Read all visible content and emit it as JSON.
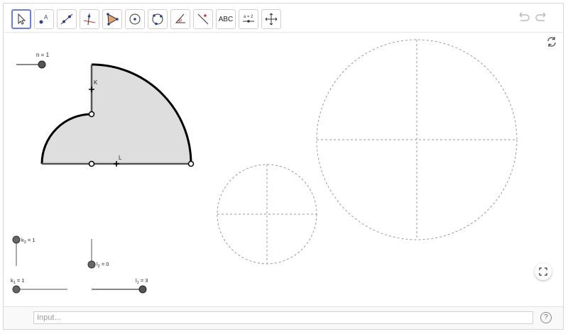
{
  "toolbar": {
    "tools": [
      {
        "name": "move",
        "icon": "arrow-cursor-icon"
      },
      {
        "name": "point",
        "icon": "point-icon"
      },
      {
        "name": "line",
        "icon": "line-icon"
      },
      {
        "name": "perpendicular",
        "icon": "perpendicular-line-icon"
      },
      {
        "name": "polygon",
        "icon": "polygon-icon"
      },
      {
        "name": "circle-center-point",
        "icon": "circle-center-icon"
      },
      {
        "name": "circle-three-points",
        "icon": "circle-three-points-icon"
      },
      {
        "name": "angle",
        "icon": "angle-icon"
      },
      {
        "name": "reflect",
        "icon": "reflect-icon"
      },
      {
        "name": "text",
        "icon": "text-icon",
        "label": "ABC"
      },
      {
        "name": "slider",
        "icon": "slider-icon",
        "label": "a = 2"
      },
      {
        "name": "move-graphics",
        "icon": "move-graphics-icon"
      }
    ],
    "undo_icon": "undo-icon",
    "redo_icon": "redo-icon"
  },
  "sliders": {
    "n_label": "n = 1",
    "k2_label": "k",
    "k2_sub": "2",
    "k2_value": " = 1",
    "l2_label": "l",
    "l2_sub": "2",
    "l2_value": " = 0",
    "k1_label": "k",
    "k1_sub": "1",
    "k1_value": " = 1",
    "l1_label": "l",
    "l1_sub": "1",
    "l1_value": " = 3"
  },
  "shape_labels": {
    "K": "K",
    "L": "L"
  },
  "input": {
    "placeholder": "Input..."
  },
  "help_label": "?",
  "colors": {
    "shape_fill": "#dedede",
    "accent": "#6a7de0",
    "slider_knob": "#555555",
    "dashed": "#999999"
  }
}
